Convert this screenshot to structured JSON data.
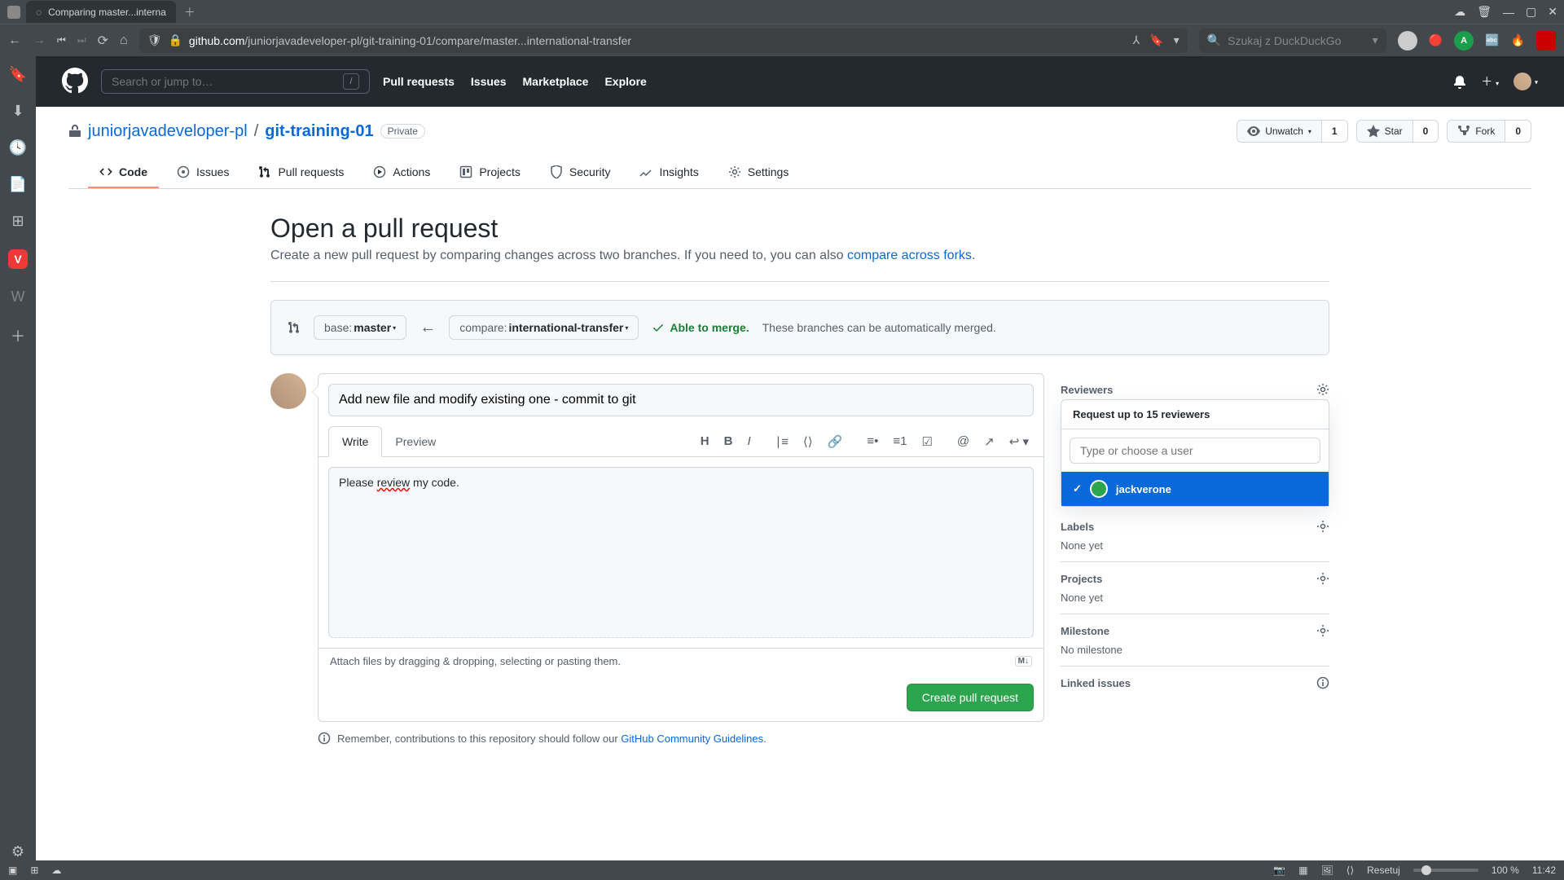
{
  "browser": {
    "tab_title": "Comparing master...interna",
    "url_prefix": "github.com",
    "url_path": "/juniorjavadeveloper-pl/git-training-01/compare/master...international-transfer",
    "search_placeholder": "Szukaj z DuckDuckGo"
  },
  "gh_header": {
    "search_placeholder": "Search or jump to…",
    "slash": "/",
    "nav": {
      "pulls": "Pull requests",
      "issues": "Issues",
      "marketplace": "Marketplace",
      "explore": "Explore"
    }
  },
  "repo": {
    "owner": "juniorjavadeveloper-pl",
    "name": "git-training-01",
    "visibility": "Private",
    "actions": {
      "unwatch": "Unwatch",
      "watch_count": "1",
      "star": "Star",
      "star_count": "0",
      "fork": "Fork",
      "fork_count": "0"
    },
    "tabs": {
      "code": "Code",
      "issues": "Issues",
      "pulls": "Pull requests",
      "actions": "Actions",
      "projects": "Projects",
      "security": "Security",
      "insights": "Insights",
      "settings": "Settings"
    }
  },
  "pr": {
    "title": "Open a pull request",
    "subtitle_a": "Create a new pull request by comparing changes across two branches. If you need to, you can also ",
    "subtitle_link": "compare across forks",
    "subtitle_b": ".",
    "base_label": "base: ",
    "base_val": "master",
    "compare_label": "compare: ",
    "compare_val": "international-transfer",
    "merge_ok": "Able to merge.",
    "merge_txt": " These branches can be automatically merged.",
    "title_value": "Add new file and modify existing one - commit to git",
    "write": "Write",
    "preview": "Preview",
    "body_pre": "Please ",
    "body_err": "review",
    "body_post": " my code.",
    "attach": "Attach files by dragging & dropping, selecting or pasting them.",
    "md": "M↓",
    "submit": "Create pull request",
    "guideline_a": "Remember, contributions to this repository should follow our ",
    "guideline_link": "GitHub Community Guidelines",
    "guideline_b": "."
  },
  "sidebar": {
    "reviewers": "Reviewers",
    "reviewer_popup": {
      "title": "Request up to 15 reviewers",
      "placeholder": "Type or choose a user",
      "selected": "jackverone"
    },
    "labels": "Labels",
    "labels_val": "None yet",
    "projects": "Projects",
    "projects_val": "None yet",
    "milestone": "Milestone",
    "milestone_val": "No milestone",
    "linked": "Linked issues"
  },
  "status": {
    "resetuj": "Resetuj",
    "zoom": "100 %",
    "time": "11:42"
  }
}
